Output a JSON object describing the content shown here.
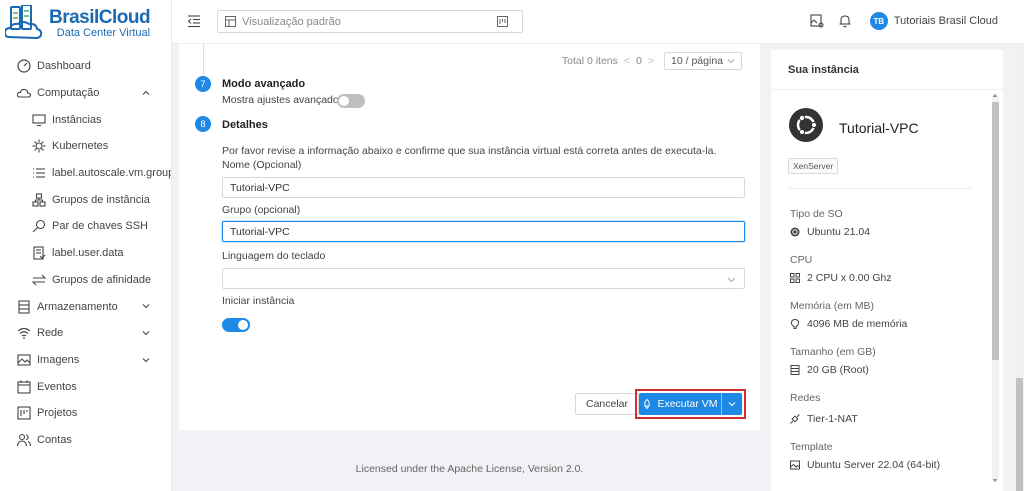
{
  "brand": {
    "name": "BrasilCloud",
    "subtitle": "Data Center Virtual"
  },
  "sidebar": {
    "items": [
      {
        "label": "Dashboard",
        "icon": "dashboard-icon"
      },
      {
        "label": "Computação",
        "icon": "cloud-icon",
        "expanded": true
      },
      {
        "label": "Instâncias",
        "icon": "desktop-icon"
      },
      {
        "label": "Kubernetes",
        "icon": "kubernetes-icon"
      },
      {
        "label": "label.autoscale.vm.groups",
        "icon": "list-icon"
      },
      {
        "label": "Grupos de instância",
        "icon": "cluster-icon"
      },
      {
        "label": "Par de chaves SSH",
        "icon": "key-icon"
      },
      {
        "label": "label.user.data",
        "icon": "file-icon"
      },
      {
        "label": "Grupos de afinidade",
        "icon": "swap-icon"
      },
      {
        "label": "Armazenamento",
        "icon": "database-icon",
        "expanded": false
      },
      {
        "label": "Rede",
        "icon": "wifi-icon",
        "expanded": false
      },
      {
        "label": "Imagens",
        "icon": "picture-icon",
        "expanded": false
      },
      {
        "label": "Eventos",
        "icon": "schedule-icon"
      },
      {
        "label": "Projetos",
        "icon": "project-icon"
      },
      {
        "label": "Contas",
        "icon": "team-icon"
      }
    ]
  },
  "header": {
    "view_placeholder": "Visualização padrão",
    "user_initials": "TB",
    "user_name": "Tutoriais Brasil Cloud"
  },
  "pager": {
    "total": "Total 0 itens",
    "page": "0",
    "page_size": "10 / página"
  },
  "steps": {
    "s7": {
      "number": "7",
      "title": "Modo avançado",
      "toggle_label": "Mostra ajustes avançados",
      "toggle_on": false
    },
    "s8": {
      "number": "8",
      "title": "Detalhes",
      "description": "Por favor revise a informação abaixo e confirme que sua instância virtual está correta antes de executa-la.",
      "name_label": "Nome (Opcional)",
      "name_value": "Tutorial-VPC",
      "group_label": "Grupo (opcional)",
      "group_value": "Tutorial-VPC",
      "keyboard_label": "Linguagem do teclado",
      "keyboard_value": "",
      "start_label": "Iniciar instância",
      "start_on": true
    }
  },
  "actions": {
    "cancel": "Cancelar",
    "run": "Executar VM"
  },
  "footer": {
    "prefix": "Licensed under the ",
    "link": "Apache License",
    "suffix": ", Version 2.0."
  },
  "instance_panel": {
    "title": "Sua instância",
    "vm_name": "Tutorial-VPC",
    "hypervisor": "XenServer",
    "os_label": "Tipo de SO",
    "os_value": "Ubuntu 21.04",
    "cpu_label": "CPU",
    "cpu_value": "2 CPU x 0.00 Ghz",
    "mem_label": "Memória (em MB)",
    "mem_value": "4096 MB de memória",
    "size_label": "Tamanho (em GB)",
    "size_value": "20 GB (Root)",
    "net_label": "Redes",
    "net_value": "Tier-1-NAT",
    "tpl_label": "Template",
    "tpl_value": "Ubuntu Server 22.04 (64-bit)"
  },
  "colors": {
    "primary": "#1e88e5",
    "highlight": "#d32f2f",
    "brand": "#1a6ab3"
  }
}
